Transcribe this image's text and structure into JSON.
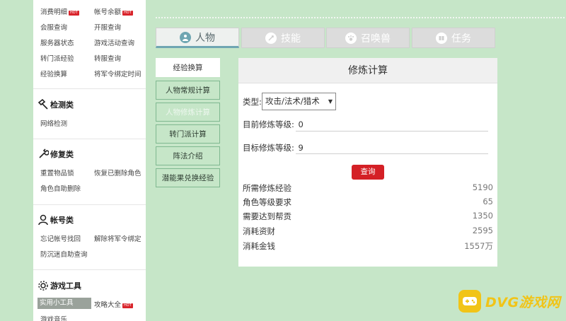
{
  "sidebar": {
    "links": [
      [
        "消费明细",
        "帐号余额"
      ],
      [
        "会服查询",
        "开服查询"
      ],
      [
        "服务器状态",
        "游戏活动查询"
      ],
      [
        "转门派经验",
        "转服查询"
      ],
      [
        "经验换算",
        "将军令绑定时间"
      ]
    ],
    "hot_badge": "HOT",
    "sections": [
      {
        "title": "检测类",
        "items": [
          [
            "网络检测",
            ""
          ]
        ]
      },
      {
        "title": "修复类",
        "items": [
          [
            "重置物品锁",
            "恢复已删除角色"
          ],
          [
            "角色自助删除",
            ""
          ]
        ]
      },
      {
        "title": "帐号类",
        "items": [
          [
            "忘记帐号找回",
            "解除将军令绑定"
          ],
          [
            "防沉迷自助查询",
            ""
          ]
        ]
      },
      {
        "title": "游戏工具",
        "items": [
          [
            "实用小工具",
            "攻略大全"
          ],
          [
            "游戏音乐",
            ""
          ]
        ]
      }
    ]
  },
  "tabs": [
    {
      "label": "人物",
      "active": true
    },
    {
      "label": "技能",
      "active": false
    },
    {
      "label": "召唤兽",
      "active": false
    },
    {
      "label": "任务",
      "active": false
    }
  ],
  "side_menu": [
    "经验换算",
    "人物常规计算",
    "人物修炼计算",
    "转门派计算",
    "阵法介绍",
    "潜能果兑换经验"
  ],
  "panel": {
    "title": "修炼计算",
    "type_label": "类型:",
    "type_value": "攻击/法术/猎术",
    "current_label": "目前修炼等级:",
    "current_value": "0",
    "target_label": "目标修炼等级:",
    "target_value": "9",
    "query_button": "查询",
    "results": [
      {
        "label": "所需修炼经验",
        "value": "5190"
      },
      {
        "label": "角色等级要求",
        "value": "65"
      },
      {
        "label": "需要达到帮贡",
        "value": "1350"
      },
      {
        "label": "消耗资财",
        "value": "2595"
      },
      {
        "label": "消耗金钱",
        "value": "1557万"
      }
    ]
  },
  "logo_text": "DVG游戏网",
  "colors": {
    "background": "#c6e6c8",
    "accent": "#6fa6b2",
    "query": "#d42026",
    "logo": "#f1c417"
  }
}
